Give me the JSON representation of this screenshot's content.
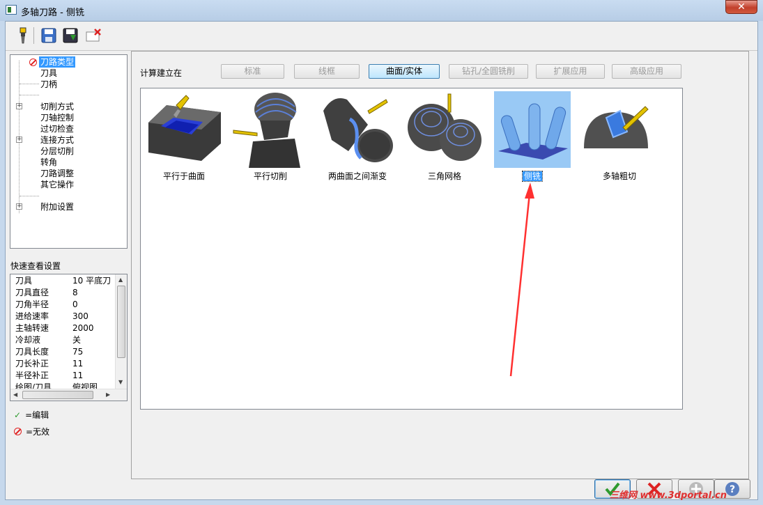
{
  "window": {
    "title": "多轴刀路 - 侧铣",
    "close_glyph": "✕"
  },
  "toolbar": {
    "buttons": [
      "tool-icon",
      "save-icon",
      "save-as-icon",
      "delete-icon"
    ]
  },
  "tree": {
    "items": [
      {
        "label": "刀路类型",
        "selected": true,
        "invalid": true
      },
      {
        "label": "刀具"
      },
      {
        "label": "刀柄"
      },
      {
        "label": "切削方式",
        "expandable": true
      },
      {
        "label": "刀轴控制"
      },
      {
        "label": "过切检查"
      },
      {
        "label": "连接方式",
        "expandable": true
      },
      {
        "label": "分层切削"
      },
      {
        "label": "转角"
      },
      {
        "label": "刀路调整"
      },
      {
        "label": "其它操作"
      },
      {
        "label": "附加设置",
        "expandable": true
      }
    ]
  },
  "quick_settings": {
    "title": "快速查看设置",
    "rows": [
      {
        "name": "刀具",
        "value": "10 平底刀"
      },
      {
        "name": "刀具直径",
        "value": "8"
      },
      {
        "name": "刀角半径",
        "value": "0"
      },
      {
        "name": "进给速率",
        "value": "300"
      },
      {
        "name": "主轴转速",
        "value": "2000"
      },
      {
        "name": "冷却液",
        "value": "关"
      },
      {
        "name": "刀具长度",
        "value": "75"
      },
      {
        "name": "刀长补正",
        "value": "11"
      },
      {
        "name": "半径补正",
        "value": "11"
      },
      {
        "name": "绘图/刀具",
        "value": "俯视图"
      }
    ]
  },
  "legend": {
    "edit": "=编辑",
    "invalid": "=无效"
  },
  "main": {
    "calc_label": "计算建立在",
    "categories": [
      {
        "label": "标准",
        "active": false
      },
      {
        "label": "线框",
        "active": false
      },
      {
        "label": "曲面/实体",
        "active": true
      },
      {
        "label": "钻孔/全圆铣削",
        "active": false
      },
      {
        "label": "扩展应用",
        "active": false
      },
      {
        "label": "高级应用",
        "active": false
      }
    ],
    "types": [
      {
        "label": "平行于曲面",
        "selected": false
      },
      {
        "label": "平行切削",
        "selected": false
      },
      {
        "label": "两曲面之间渐变",
        "selected": false
      },
      {
        "label": "三角网格",
        "selected": false
      },
      {
        "label": "侧铣",
        "selected": true
      },
      {
        "label": "多轴粗切",
        "selected": false
      }
    ]
  },
  "footer": {
    "watermark": "三维网 www.3dportal.cn"
  },
  "colors": {
    "accent": "#3399ff",
    "arrow": "#ff3030"
  }
}
